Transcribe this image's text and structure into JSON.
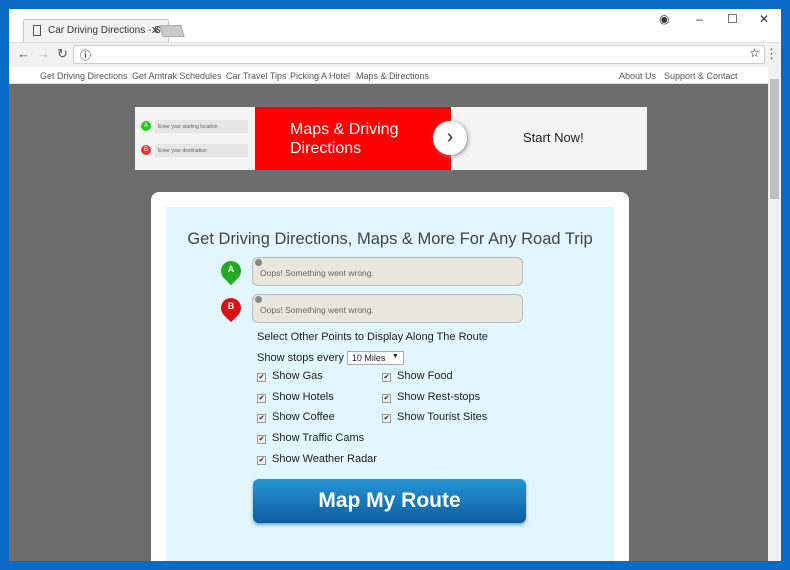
{
  "browser": {
    "tab_title": "Car Driving Directions - S",
    "url": ""
  },
  "nav": {
    "left": [
      "Get Driving Directions",
      "Get Amtrak Schedules",
      "Car Travel Tips",
      "Picking A Hotel",
      "Maps & Directions"
    ],
    "right": [
      "About Us",
      "Support & Contact"
    ]
  },
  "banner": {
    "start_placeholder": "Enter your starting location",
    "dest_placeholder": "Enter your destination",
    "headline": "Maps & Driving Directions",
    "cta": "Start Now!",
    "start_marker": "A",
    "dest_marker": "B"
  },
  "form": {
    "title": "Get Driving Directions, Maps & More For Any Road Trip",
    "point_a": "A",
    "point_b": "B",
    "input_a": "Oops! Something went wrong.",
    "input_b": "Oops! Something went wrong.",
    "options_label": "Select Other Points to Display Along The Route",
    "stops_label": "Show stops every",
    "stops_value": "10 Miles",
    "checkboxes": [
      {
        "label": "Show Gas",
        "checked": true
      },
      {
        "label": "Show Food",
        "checked": true
      },
      {
        "label": "Show Hotels",
        "checked": true
      },
      {
        "label": "Show Rest-stops",
        "checked": true
      },
      {
        "label": "Show Coffee",
        "checked": true
      },
      {
        "label": "Show Tourist Sites",
        "checked": true
      },
      {
        "label": "Show Traffic Cams",
        "checked": true
      },
      {
        "label": "Show Weather Radar",
        "checked": true
      }
    ],
    "submit": "Map My Route"
  },
  "colors": {
    "frame": "#0a6ac4",
    "banner_red": "#ff0000",
    "button": "#1a7fc4",
    "panel": "#e1f6fd"
  }
}
